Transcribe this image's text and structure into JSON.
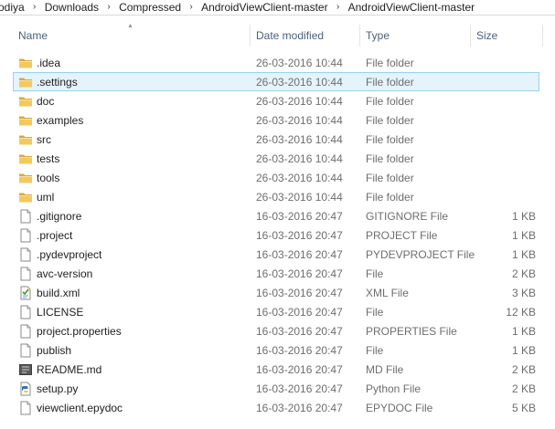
{
  "breadcrumb": [
    "odiya",
    "Downloads",
    "Compressed",
    "AndroidViewClient-master",
    "AndroidViewClient-master"
  ],
  "columns": {
    "name": "Name",
    "date": "Date modified",
    "type": "Type",
    "size": "Size"
  },
  "colors": {
    "selected_bg": "#e5f3fb",
    "selected_border": "#99d1ef",
    "folder": "#e8b84a",
    "header_text": "#4c607a"
  },
  "files": [
    {
      "name": ".idea",
      "date": "26-03-2016 10:44",
      "type": "File folder",
      "size": "",
      "icon": "folder-icon",
      "selected": false
    },
    {
      "name": ".settings",
      "date": "26-03-2016 10:44",
      "type": "File folder",
      "size": "",
      "icon": "folder-icon",
      "selected": true
    },
    {
      "name": "doc",
      "date": "26-03-2016 10:44",
      "type": "File folder",
      "size": "",
      "icon": "folder-icon",
      "selected": false
    },
    {
      "name": "examples",
      "date": "26-03-2016 10:44",
      "type": "File folder",
      "size": "",
      "icon": "folder-icon",
      "selected": false
    },
    {
      "name": "src",
      "date": "26-03-2016 10:44",
      "type": "File folder",
      "size": "",
      "icon": "folder-icon",
      "selected": false
    },
    {
      "name": "tests",
      "date": "26-03-2016 10:44",
      "type": "File folder",
      "size": "",
      "icon": "folder-icon",
      "selected": false
    },
    {
      "name": "tools",
      "date": "26-03-2016 10:44",
      "type": "File folder",
      "size": "",
      "icon": "folder-icon",
      "selected": false
    },
    {
      "name": "uml",
      "date": "26-03-2016 10:44",
      "type": "File folder",
      "size": "",
      "icon": "folder-icon",
      "selected": false
    },
    {
      "name": ".gitignore",
      "date": "16-03-2016 20:47",
      "type": "GITIGNORE File",
      "size": "1 KB",
      "icon": "file-icon",
      "selected": false
    },
    {
      "name": ".project",
      "date": "16-03-2016 20:47",
      "type": "PROJECT File",
      "size": "1 KB",
      "icon": "file-icon",
      "selected": false
    },
    {
      "name": ".pydevproject",
      "date": "16-03-2016 20:47",
      "type": "PYDEVPROJECT File",
      "size": "1 KB",
      "icon": "file-icon",
      "selected": false
    },
    {
      "name": "avc-version",
      "date": "16-03-2016 20:47",
      "type": "File",
      "size": "2 KB",
      "icon": "file-icon",
      "selected": false
    },
    {
      "name": "build.xml",
      "date": "16-03-2016 20:47",
      "type": "XML File",
      "size": "3 KB",
      "icon": "xml-file-icon",
      "selected": false
    },
    {
      "name": "LICENSE",
      "date": "16-03-2016 20:47",
      "type": "File",
      "size": "12 KB",
      "icon": "file-icon",
      "selected": false
    },
    {
      "name": "project.properties",
      "date": "16-03-2016 20:47",
      "type": "PROPERTIES File",
      "size": "1 KB",
      "icon": "file-icon",
      "selected": false
    },
    {
      "name": "publish",
      "date": "16-03-2016 20:47",
      "type": "File",
      "size": "1 KB",
      "icon": "file-icon",
      "selected": false
    },
    {
      "name": "README.md",
      "date": "16-03-2016 20:47",
      "type": "MD File",
      "size": "2 KB",
      "icon": "md-file-icon",
      "selected": false
    },
    {
      "name": "setup.py",
      "date": "16-03-2016 20:47",
      "type": "Python File",
      "size": "2 KB",
      "icon": "python-file-icon",
      "selected": false
    },
    {
      "name": "viewclient.epydoc",
      "date": "16-03-2016 20:47",
      "type": "EPYDOC File",
      "size": "5 KB",
      "icon": "file-icon",
      "selected": false
    }
  ]
}
